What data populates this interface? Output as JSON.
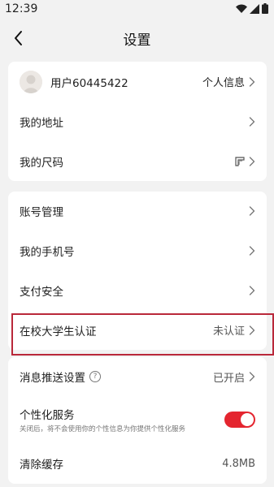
{
  "status": {
    "time": "12:39"
  },
  "header": {
    "title": "设置"
  },
  "profile": {
    "username": "用户60445422",
    "info_label": "个人信息"
  },
  "group1": {
    "items": [
      {
        "label": "我的地址"
      },
      {
        "label": "我的尺码"
      }
    ]
  },
  "group2": {
    "items": [
      {
        "label": "账号管理"
      },
      {
        "label": "我的手机号"
      },
      {
        "label": "支付安全"
      },
      {
        "label": "在校大学生认证",
        "value": "未认证"
      }
    ]
  },
  "group3": {
    "items": [
      {
        "label": "消息推送设置",
        "value": "已开启"
      },
      {
        "label": "个性化服务",
        "subtext": "关闭后，将不会使用你的个性信息为你提供个性化服务",
        "toggle_on": true
      },
      {
        "label": "清除缓存",
        "value": "4.8MB"
      }
    ]
  },
  "icons": {
    "back": "back-arrow-icon",
    "chevron": "chevron-right-icon",
    "size": "ruler-icon",
    "info": "help-circle-icon",
    "wifi": "wifi-icon",
    "signal": "signal-icon",
    "battery": "battery-icon"
  },
  "colors": {
    "toggle_active": "#e4252f",
    "highlight_border": "#b9283a",
    "background": "#f2f2f2"
  }
}
